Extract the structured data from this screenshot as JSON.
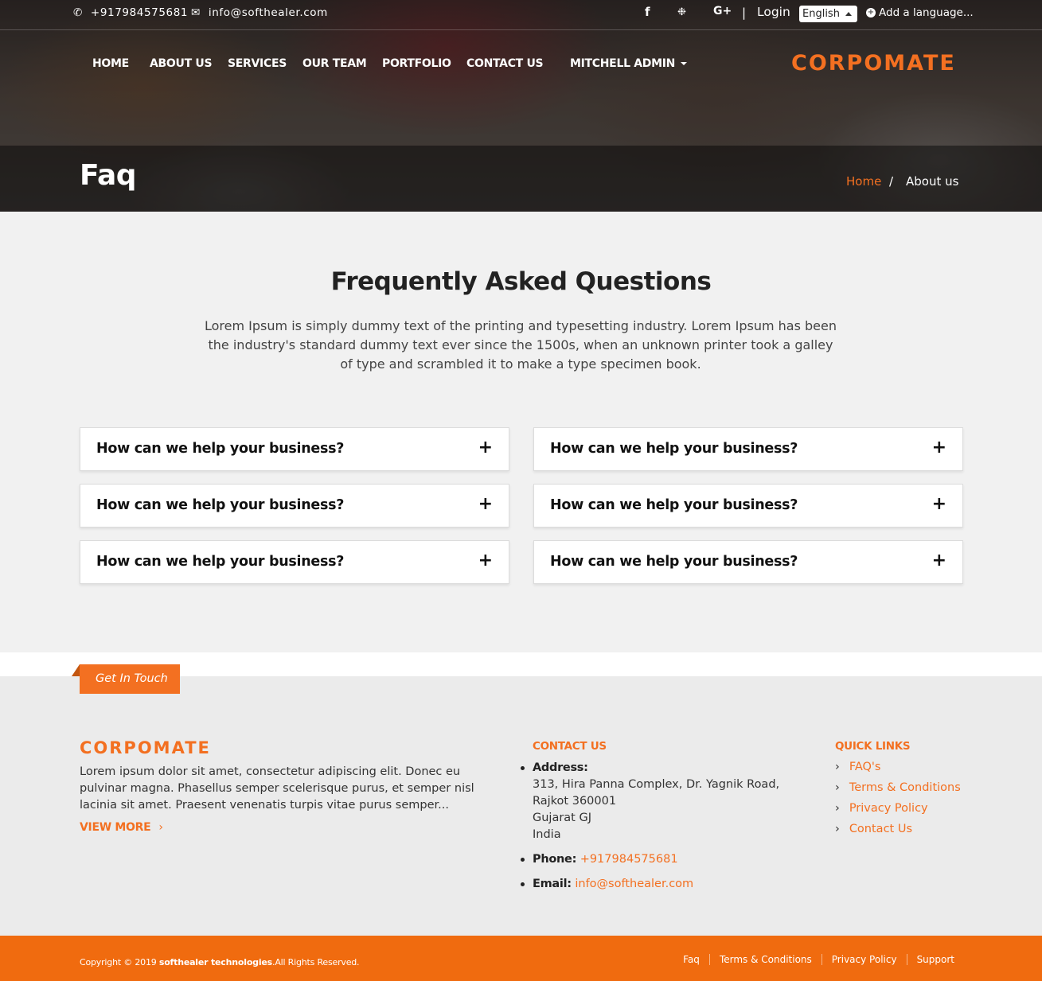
{
  "topbar": {
    "phone": "+917984575681",
    "email": "info@softhealer.com",
    "social_icons": [
      "facebook-icon",
      "twitter-icon",
      "google-plus-icon"
    ],
    "separator": "|",
    "login": "Login",
    "language_selected": "English",
    "add_language": "Add a language..."
  },
  "nav": {
    "items": [
      "HOME",
      "ABOUT US",
      "SERVICES",
      "OUR TEAM",
      "PORTFOLIO",
      "CONTACT US"
    ],
    "user_menu": "MITCHELL ADMIN",
    "logo": "CORPOMATE"
  },
  "page_header": {
    "title": "Faq",
    "breadcrumb_home": "Home",
    "breadcrumb_sep": "/",
    "breadcrumb_current": "About us"
  },
  "faq": {
    "title": "Frequently Asked Questions",
    "intro": "Lorem Ipsum is simply dummy text of the printing and typesetting industry. Lorem Ipsum has been the industry's standard dummy text ever since the 1500s, when an unknown printer took a galley of type and scrambled it to make a type specimen book.",
    "questions": [
      "How can we help your business?",
      "How can we help your business?",
      "How can we help your business?",
      "How can we help your business?",
      "How can we help your business?",
      "How can we help your business?"
    ],
    "expand_symbol": "+"
  },
  "footer": {
    "tag": "Get In Touch",
    "logo": "CORPOMATE",
    "about": "Lorem ipsum dolor sit amet, consectetur adipiscing elit. Donec eu pulvinar magna. Phasellus semper scelerisque purus, et semper nisl lacinia sit amet. Praesent venenatis turpis vitae purus semper...",
    "view_more": "VIEW MORE",
    "contact_heading": "CONTACT US",
    "address_label": "Address:",
    "address_lines": [
      "313, Hira Panna Complex, Dr. Yagnik Road,",
      "Rajkot 360001",
      "Gujarat GJ",
      "India"
    ],
    "phone_label": "Phone:",
    "phone": "+917984575681",
    "email_label": "Email:",
    "email": "info@softhealer.com",
    "quick_heading": "QUICK LINKS",
    "quick_links": [
      "FAQ's",
      "Terms & Conditions",
      "Privacy Policy",
      "Contact Us"
    ]
  },
  "bottom_bar": {
    "copyright_prefix": "Copyright © 2019",
    "company": "softhealer technologies",
    "copyright_suffix": ".All Rights Reserved.",
    "links": [
      "Faq",
      "Terms & Conditions",
      "Privacy Policy",
      "Support"
    ]
  },
  "colors": {
    "accent": "#f37021",
    "footer_bg": "#ebebeb",
    "page_bg": "#f1f1f1"
  }
}
